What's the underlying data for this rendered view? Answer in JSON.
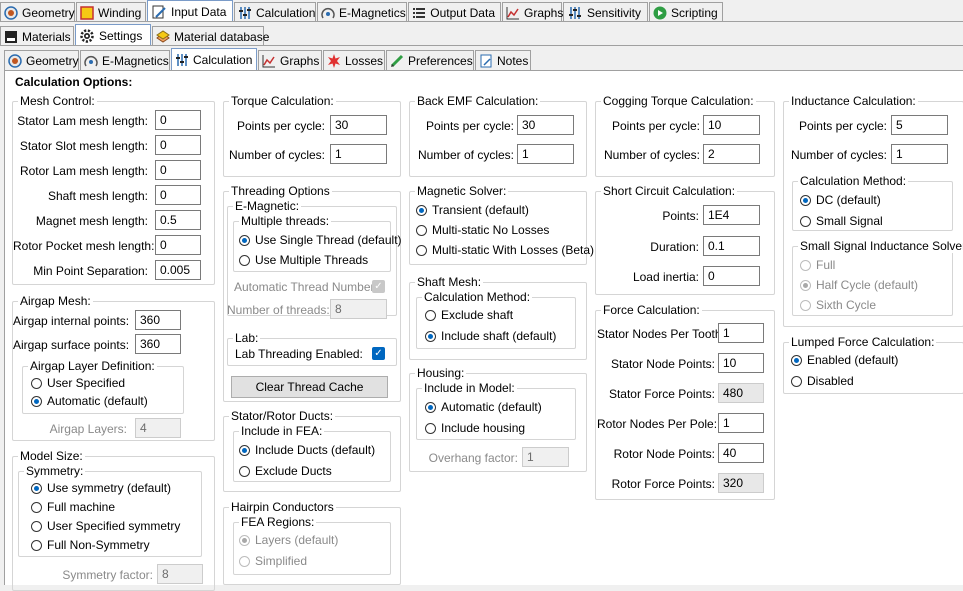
{
  "tabs_main": [
    {
      "label": "Geometry",
      "icon": "geometry-icon"
    },
    {
      "label": "Winding",
      "icon": "winding-icon"
    },
    {
      "label": "Input Data",
      "icon": "input-data-icon"
    },
    {
      "label": "Calculation",
      "icon": "calculation-icon"
    },
    {
      "label": "E-Magnetics",
      "icon": "e-magnetics-icon"
    },
    {
      "label": "Output Data",
      "icon": "output-data-icon"
    },
    {
      "label": "Graphs",
      "icon": "graphs-icon"
    },
    {
      "label": "Sensitivity",
      "icon": "sensitivity-icon"
    },
    {
      "label": "Scripting",
      "icon": "scripting-icon"
    }
  ],
  "tabs_sub": [
    {
      "label": "Materials",
      "icon": "materials-icon"
    },
    {
      "label": "Settings",
      "icon": "settings-icon"
    },
    {
      "label": "Material database",
      "icon": "material-database-icon"
    }
  ],
  "tabs_third": [
    {
      "label": "Geometry",
      "icon": "geometry-icon"
    },
    {
      "label": "E-Magnetics",
      "icon": "e-magnetics-icon"
    },
    {
      "label": "Calculation",
      "icon": "calculation-icon"
    },
    {
      "label": "Graphs",
      "icon": "graphs-icon"
    },
    {
      "label": "Losses",
      "icon": "losses-icon"
    },
    {
      "label": "Preferences",
      "icon": "preferences-icon"
    },
    {
      "label": "Notes",
      "icon": "notes-icon"
    }
  ],
  "page_title": "Calculation Options:",
  "mesh": {
    "title": "Mesh Control:",
    "stator_lam_label": "Stator Lam mesh length:",
    "stator_lam": "0",
    "stator_slot_label": "Stator Slot mesh length:",
    "stator_slot": "0",
    "rotor_lam_label": "Rotor Lam mesh length:",
    "rotor_lam": "0",
    "shaft_label": "Shaft mesh length:",
    "shaft": "0",
    "magnet_label": "Magnet mesh length:",
    "magnet": "0.5",
    "rotor_pocket_label": "Rotor Pocket mesh length:",
    "rotor_pocket": "0",
    "min_point_label": "Min Point Separation:",
    "min_point": "0.005"
  },
  "airgap": {
    "title": "Airgap Mesh:",
    "internal_label": "Airgap internal points:",
    "internal": "360",
    "surface_label": "Airgap surface points:",
    "surface": "360",
    "layer_title": "Airgap Layer Definition:",
    "user_specified": "User Specified",
    "automatic": "Automatic (default)",
    "layers_label": "Airgap Layers:",
    "layers": "4"
  },
  "model_size": {
    "title": "Model Size:",
    "symmetry_title": "Symmetry:",
    "use_symmetry": "Use symmetry (default)",
    "full_machine": "Full machine",
    "user_symmetry": "User Specified symmetry",
    "full_non_symmetry": "Full Non-Symmetry",
    "factor_label": "Symmetry factor:",
    "factor": "8"
  },
  "torque": {
    "title": "Torque Calculation:",
    "ppc_label": "Points per cycle:",
    "ppc": "30",
    "cycles_label": "Number of cycles:",
    "cycles": "1"
  },
  "threading": {
    "title": "Threading Options",
    "emag_title": "E-Magnetic:",
    "multiple_title": "Multiple threads:",
    "single": "Use Single Thread (default)",
    "multi": "Use Multiple Threads",
    "auto_label": "Automatic Thread Number:",
    "num_label": "Number of threads:",
    "num": "8",
    "lab_title": "Lab:",
    "lab_label": "Lab Threading Enabled:",
    "clear_button": "Clear Thread Cache"
  },
  "ducts": {
    "title": "Stator/Rotor Ducts:",
    "include_title": "Include in FEA:",
    "include": "Include Ducts (default)",
    "exclude": "Exclude Ducts"
  },
  "hairpin": {
    "title": "Hairpin Conductors",
    "regions_title": "FEA Regions:",
    "layers": "Layers (default)",
    "simplified": "Simplified"
  },
  "backemf": {
    "title": "Back EMF Calculation:",
    "ppc_label": "Points per cycle:",
    "ppc": "30",
    "cycles_label": "Number of cycles:",
    "cycles": "1"
  },
  "solver": {
    "title": "Magnetic Solver:",
    "transient": "Transient (default)",
    "no_losses": "Multi-static No Losses",
    "with_losses": "Multi-static With Losses (Beta)"
  },
  "shaft_mesh": {
    "title": "Shaft Mesh:",
    "method_title": "Calculation Method:",
    "exclude": "Exclude shaft",
    "include": "Include shaft (default)"
  },
  "housing": {
    "title": "Housing:",
    "include_title": "Include in Model:",
    "automatic": "Automatic (default)",
    "include": "Include housing",
    "overhang_label": "Overhang factor:",
    "overhang": "1"
  },
  "cogging": {
    "title": "Cogging Torque Calculation:",
    "ppc_label": "Points per cycle:",
    "ppc": "10",
    "cycles_label": "Number of cycles:",
    "cycles": "2"
  },
  "short_circuit": {
    "title": "Short Circuit Calculation:",
    "points_label": "Points:",
    "points": "1E4",
    "duration_label": "Duration:",
    "duration": "0.1",
    "inertia_label": "Load inertia:",
    "inertia": "0"
  },
  "force": {
    "title": "Force Calculation:",
    "stator_nodes_tooth_label": "Stator Nodes Per Tooth:",
    "stator_nodes_tooth": "1",
    "stator_node_points_label": "Stator Node Points:",
    "stator_node_points": "10",
    "stator_force_points_label": "Stator Force Points:",
    "stator_force_points": "480",
    "rotor_nodes_pole_label": "Rotor Nodes Per Pole:",
    "rotor_nodes_pole": "1",
    "rotor_node_points_label": "Rotor Node Points:",
    "rotor_node_points": "40",
    "rotor_force_points_label": "Rotor Force Points:",
    "rotor_force_points": "320"
  },
  "inductance": {
    "title": "Inductance Calculation:",
    "ppc_label": "Points per cycle:",
    "ppc": "5",
    "cycles_label": "Number of cycles:",
    "cycles": "1",
    "method_title": "Calculation Method:",
    "dc": "DC (default)",
    "small_signal": "Small Signal",
    "ss_solver_title": "Small Signal Inductance Solver:",
    "full": "Full",
    "half": "Half Cycle (default)",
    "sixth": "Sixth Cycle"
  },
  "lumped": {
    "title": "Lumped Force Calculation:",
    "enabled": "Enabled (default)",
    "disabled": "Disabled"
  }
}
